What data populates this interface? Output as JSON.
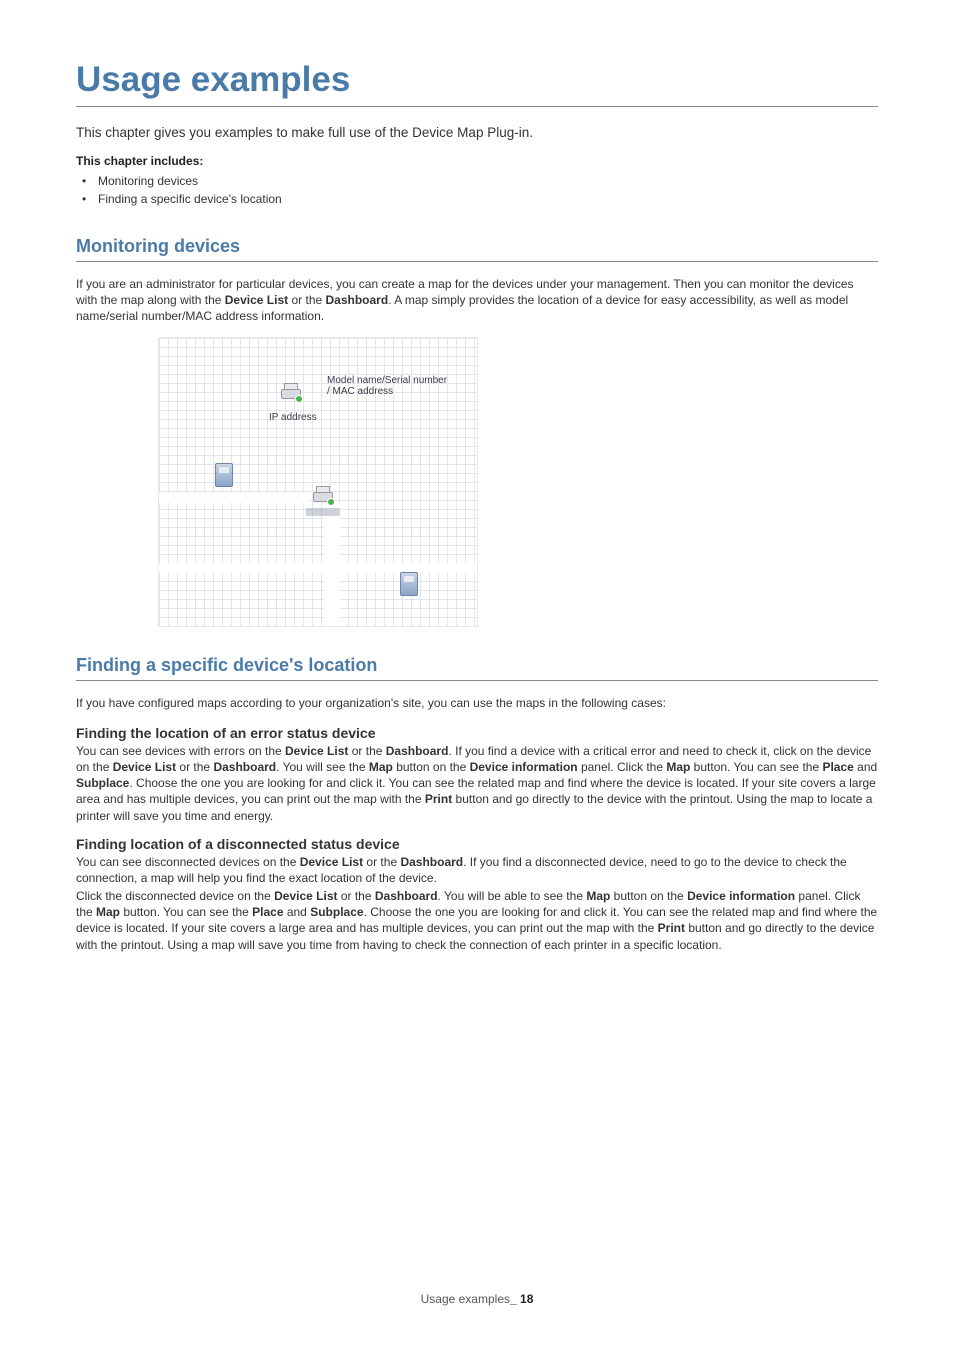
{
  "title": "Usage examples",
  "intro": "This chapter gives you examples to make full use of the Device Map Plug-in.",
  "includes_label": "This chapter includes:",
  "includes": [
    "Monitoring devices",
    "Finding a specific device's location"
  ],
  "section1": {
    "heading": "Monitoring devices",
    "para_pre": "If you are an administrator for particular devices, you can create a map for the devices under your management. Then you can monitor the devices with the map along with the ",
    "device_list": "Device List",
    "mid1": " or the ",
    "dashboard": "Dashboard",
    "para_post": ". A map simply provides the location of a device for easy accessibility, as well as model name/serial number/MAC address information."
  },
  "figure": {
    "model_line": "Model name/Serial number",
    "mac_line": "/ MAC address",
    "ip_line": "IP address"
  },
  "section2": {
    "heading": "Finding a specific device's location",
    "intro": "If you have configured maps according to your organization's site, you can use the maps in the following cases:",
    "sub1_heading": "Finding the location of an error status device",
    "sub1": {
      "t1": "You can see devices with errors on the ",
      "b1": "Device List",
      "t2": " or the ",
      "b2": "Dashboard",
      "t3": ". If you find a device with a critical error and need to check it, click on the device on the ",
      "b3": "Device List",
      "t4": " or the ",
      "b4": "Dashboard",
      "t5": ". You will see the ",
      "b5": "Map",
      "t6": " button on the ",
      "b6": "Device information",
      "t7": " panel. Click the ",
      "b7": "Map",
      "t8": " button. You can see the ",
      "b8": "Place",
      "t9": " and ",
      "b9": "Subplace",
      "t10": ". Choose the one you are looking for and click it. You can see the related map and find where the device is located. If your site covers a large area and has multiple devices, you can print out the map with the ",
      "b10": "Print",
      "t11": " button and go directly to the device with the printout. Using the map to locate a printer will save you time and energy."
    },
    "sub2_heading": "Finding location of a disconnected status device",
    "sub2a": {
      "t1": "You can see disconnected devices on the ",
      "b1": "Device List",
      "t2": " or the ",
      "b2": "Dashboard",
      "t3": ". If you find a disconnected device, need to go to the device to check the connection, a map will help you find the exact location of the device."
    },
    "sub2b": {
      "t1": "Click the disconnected device on the ",
      "b1": "Device List",
      "t2": " or the ",
      "b2": "Dashboard",
      "t3": ". You will be able to see the ",
      "b3": "Map",
      "t4": " button on the ",
      "b4": "Device information",
      "t5": " panel. Click the ",
      "b5": "Map",
      "t6": " button. You can see the ",
      "b6": "Place",
      "t7": " and ",
      "b7": "Subplace",
      "t8": ". Choose the one you are looking for and click it. You can see the related map and find where the device is located. If your site covers a large area and has multiple devices, you can print out the map with the ",
      "b8": "Print",
      "t9": " button and go directly to the device with the printout. Using a map will save you time from having to check the connection of each printer in a specific location."
    }
  },
  "footer": {
    "label": "Usage examples",
    "sep": "_ ",
    "page": "18"
  }
}
